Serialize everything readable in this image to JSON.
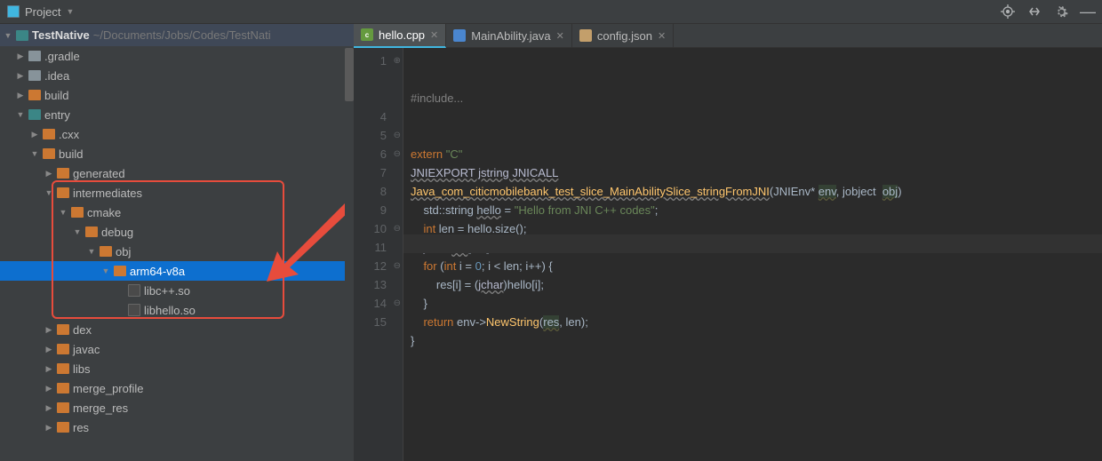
{
  "topbar": {
    "project_label": "Project"
  },
  "root": {
    "name": "TestNative",
    "path": "~/Documents/Jobs/Codes/TestNati"
  },
  "tree": [
    {
      "depth": 0,
      "caret": "closed",
      "icon": "gray",
      "label": ".gradle"
    },
    {
      "depth": 0,
      "caret": "closed",
      "icon": "gray",
      "label": ".idea"
    },
    {
      "depth": 0,
      "caret": "closed",
      "icon": "orange",
      "label": "build"
    },
    {
      "depth": 0,
      "caret": "open",
      "icon": "teal",
      "label": "entry"
    },
    {
      "depth": 1,
      "caret": "closed",
      "icon": "orange",
      "label": ".cxx"
    },
    {
      "depth": 1,
      "caret": "open",
      "icon": "orange",
      "label": "build"
    },
    {
      "depth": 2,
      "caret": "closed",
      "icon": "orange",
      "label": "generated"
    },
    {
      "depth": 2,
      "caret": "open",
      "icon": "orange",
      "label": "intermediates"
    },
    {
      "depth": 3,
      "caret": "open",
      "icon": "orange",
      "label": "cmake"
    },
    {
      "depth": 4,
      "caret": "open",
      "icon": "orange",
      "label": "debug"
    },
    {
      "depth": 5,
      "caret": "open",
      "icon": "orange",
      "label": "obj"
    },
    {
      "depth": 6,
      "caret": "open",
      "icon": "orange",
      "label": "arm64-v8a",
      "selected": true
    },
    {
      "depth": 7,
      "caret": "",
      "icon": "file",
      "label": "libc++.so"
    },
    {
      "depth": 7,
      "caret": "",
      "icon": "file",
      "label": "libhello.so"
    },
    {
      "depth": 2,
      "caret": "closed",
      "icon": "orange",
      "label": "dex"
    },
    {
      "depth": 2,
      "caret": "closed",
      "icon": "orange",
      "label": "javac"
    },
    {
      "depth": 2,
      "caret": "closed",
      "icon": "orange",
      "label": "libs"
    },
    {
      "depth": 2,
      "caret": "closed",
      "icon": "orange",
      "label": "merge_profile"
    },
    {
      "depth": 2,
      "caret": "closed",
      "icon": "orange",
      "label": "merge_res"
    },
    {
      "depth": 2,
      "caret": "closed",
      "icon": "orange",
      "label": "res"
    }
  ],
  "tabs": [
    {
      "label": "hello.cpp",
      "kind": "cpp",
      "active": true
    },
    {
      "label": "MainAbility.java",
      "kind": "java",
      "active": false
    },
    {
      "label": "config.json",
      "kind": "json",
      "active": false
    }
  ],
  "gutter": [
    "1",
    "",
    "",
    "4",
    "5",
    "6",
    "7",
    "8",
    "9",
    "10",
    "11",
    "12",
    "13",
    "14",
    "15"
  ],
  "code": {
    "l1": "#include...",
    "l4a": "extern",
    "l4b": " \"C\"",
    "l5": "JNIEXPORT jstring JNICALL",
    "l6a": "Java_com_citicmobilebank_test_slice_MainAbilitySlice_stringFromJNI",
    "l6b": "(JNIEnv* ",
    "l6c": "env",
    "l6d": ", jobject  ",
    "l6e": "obj",
    "l6f": ")",
    "l7a": "    std::string ",
    "l7b": "hello",
    "l7c": " = ",
    "l7d": "\"Hello from JNI C++ codes\"",
    "l7e": ";",
    "l8a": "    int ",
    "l8b": "len",
    "l8c": " = hello.size();",
    "l9a": "    jchar ",
    "l9b": "res",
    "l9c": "[len];",
    "l10a": "    for ",
    "l10b": "(",
    "l10c": "int ",
    "l10d": "i = ",
    "l10e": "0",
    "l10f": "; i < len; i++) {",
    "l11a": "        res[i] = (",
    "l11b": "jchar",
    "l11c": ")hello[i];",
    "l12": "    }",
    "l13a": "    return ",
    "l13b": "env->",
    "l13c": "NewString",
    "l13d": "(",
    "l13e": "res",
    "l13f": ", len);",
    "l14": "}"
  }
}
